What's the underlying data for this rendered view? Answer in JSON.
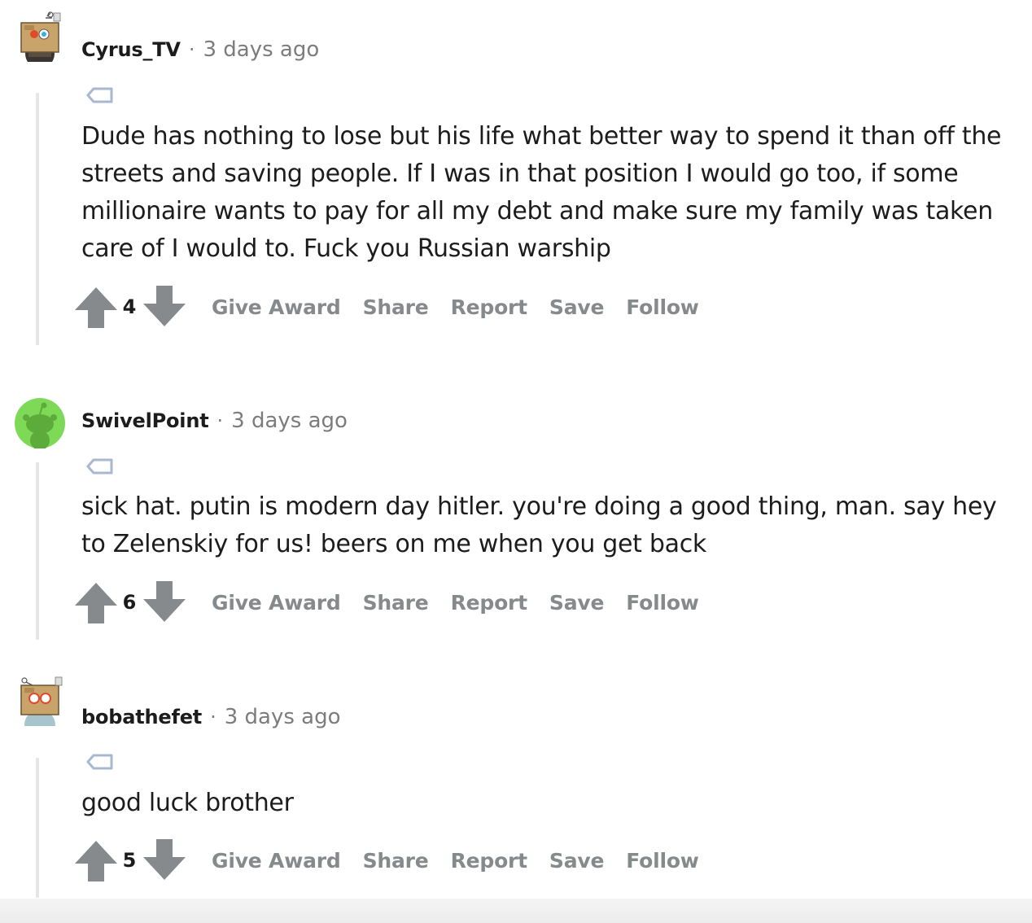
{
  "actions": {
    "give_award": "Give Award",
    "share": "Share",
    "report": "Report",
    "save": "Save",
    "follow": "Follow"
  },
  "separator": "·",
  "comments": [
    {
      "username": "Cyrus_TV",
      "time": "3 days ago",
      "avatar": "snoo-box-helmet-avatar",
      "body": "Dude has nothing to lose but his life what better way to spend it than off the streets and saving people. If I was in that position I would go too, if some millionaire wants to pay for all my debt and make sure my family was taken care of I would to. Fuck you Russian warship",
      "score": "4"
    },
    {
      "username": "SwivelPoint",
      "time": "3 days ago",
      "avatar": "default-green-snoo-avatar",
      "body": "sick hat. putin is modern day hitler. you're doing a good thing, man. say hey to Zelenskiy for us! beers on me when you get back",
      "score": "6"
    },
    {
      "username": "bobathefet",
      "time": "3 days ago",
      "avatar": "snoo-box-helmet-avatar",
      "body": "good luck brother",
      "score": "5"
    }
  ],
  "colors": {
    "text": "#1c1c1c",
    "meta": "#7c7c7c",
    "action": "#878a8c",
    "arrow": "#878a8c",
    "thread_line": "#e4e6e8",
    "flair_icon": "#a8b8d0",
    "green_avatar": "#7ed957"
  }
}
